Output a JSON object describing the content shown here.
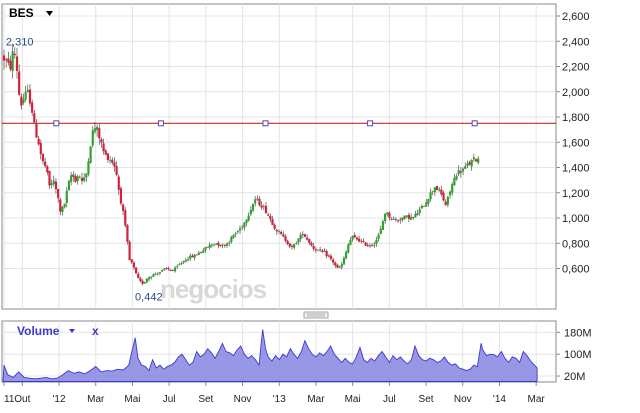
{
  "header": {
    "ticker": "BES",
    "ticker_dropdown_icon": "caret-down-icon",
    "watermark": "negocios"
  },
  "volume_panel": {
    "title": "Volume",
    "dropdown_icon": "caret-down-icon",
    "close_label": "x"
  },
  "colors": {
    "up": "#2fa32f",
    "down": "#d3213a",
    "reference_line": "#c22a2a",
    "volume_fill": "#8585e0",
    "volume_stroke": "#3a3ad0",
    "grid": "#e4e4e4"
  },
  "chart_data": [
    {
      "type": "candlestick",
      "title": "",
      "ylim": [
        400,
        2600
      ],
      "y_ticks": [
        600,
        800,
        1000,
        1200,
        1400,
        1600,
        1800,
        2000,
        2200,
        2400,
        2600
      ],
      "y_tick_labels": [
        "0,600",
        "0,800",
        "1,000",
        "1,200",
        "1,400",
        "1,600",
        "1,800",
        "2,000",
        "2,200",
        "2,400",
        "2,600"
      ],
      "x_tick_labels": [
        "11",
        "Out",
        "'12",
        "Mar",
        "Mai",
        "Jul",
        "Set",
        "Nov",
        "'13",
        "Mar",
        "Mai",
        "Jul",
        "Set",
        "Nov",
        "'14",
        "Mar"
      ],
      "x_ticks_month_index": [
        0,
        1,
        3,
        5,
        7,
        9,
        11,
        13,
        15,
        17,
        19,
        21,
        23,
        25,
        27,
        29
      ],
      "x_range_month_index": [
        -0.05,
        29.05
      ],
      "reference_line": 1750,
      "annotations": [
        {
          "label": "2,310",
          "value": 2310,
          "month_index": 0.05
        },
        {
          "label": "0,442",
          "value": 442,
          "month_index": 7.25
        }
      ],
      "series": [
        {
          "close_path": [
            [
              0.0,
              2280
            ],
            [
              0.25,
              2240
            ],
            [
              0.45,
              2180
            ],
            [
              0.65,
              2350
            ],
            [
              0.85,
              2150
            ],
            [
              1.0,
              1880
            ],
            [
              1.2,
              1950
            ],
            [
              1.4,
              2000
            ],
            [
              1.6,
              1900
            ],
            [
              1.8,
              1700
            ],
            [
              2.0,
              1600
            ],
            [
              2.2,
              1450
            ],
            [
              2.4,
              1400
            ],
            [
              2.6,
              1250
            ],
            [
              2.8,
              1300
            ],
            [
              3.0,
              1200
            ],
            [
              3.2,
              1050
            ],
            [
              3.4,
              1100
            ],
            [
              3.6,
              1250
            ],
            [
              3.8,
              1350
            ],
            [
              4.0,
              1300
            ],
            [
              4.2,
              1350
            ],
            [
              4.4,
              1280
            ],
            [
              4.6,
              1350
            ],
            [
              4.8,
              1550
            ],
            [
              5.0,
              1720
            ],
            [
              5.2,
              1700
            ],
            [
              5.4,
              1600
            ],
            [
              5.6,
              1500
            ],
            [
              5.8,
              1480
            ],
            [
              6.0,
              1450
            ],
            [
              6.2,
              1400
            ],
            [
              6.4,
              1200
            ],
            [
              6.6,
              1050
            ],
            [
              6.8,
              850
            ],
            [
              7.0,
              620
            ],
            [
              7.1,
              650
            ],
            [
              7.2,
              600
            ],
            [
              7.35,
              540
            ],
            [
              7.5,
              500
            ],
            [
              7.7,
              480
            ],
            [
              7.9,
              520
            ],
            [
              8.1,
              540
            ],
            [
              8.4,
              560
            ],
            [
              8.7,
              580
            ],
            [
              9.0,
              600
            ],
            [
              9.3,
              580
            ],
            [
              9.6,
              620
            ],
            [
              9.9,
              660
            ],
            [
              10.2,
              690
            ],
            [
              10.5,
              700
            ],
            [
              10.8,
              730
            ],
            [
              11.1,
              760
            ],
            [
              11.4,
              790
            ],
            [
              11.7,
              800
            ],
            [
              12.0,
              780
            ],
            [
              12.3,
              800
            ],
            [
              12.6,
              860
            ],
            [
              12.9,
              900
            ],
            [
              13.2,
              960
            ],
            [
              13.5,
              1050
            ],
            [
              13.8,
              1150
            ],
            [
              14.0,
              1120
            ],
            [
              14.3,
              1080
            ],
            [
              14.6,
              1000
            ],
            [
              14.9,
              920
            ],
            [
              15.2,
              870
            ],
            [
              15.5,
              820
            ],
            [
              15.8,
              760
            ],
            [
              16.1,
              820
            ],
            [
              16.4,
              880
            ],
            [
              16.7,
              820
            ],
            [
              17.0,
              760
            ],
            [
              17.3,
              740
            ],
            [
              17.6,
              720
            ],
            [
              17.9,
              680
            ],
            [
              18.1,
              640
            ],
            [
              18.3,
              600
            ],
            [
              18.5,
              620
            ],
            [
              18.7,
              700
            ],
            [
              18.9,
              800
            ],
            [
              19.1,
              850
            ],
            [
              19.4,
              830
            ],
            [
              19.7,
              800
            ],
            [
              20.0,
              780
            ],
            [
              20.3,
              800
            ],
            [
              20.6,
              880
            ],
            [
              20.9,
              1050
            ],
            [
              21.2,
              1000
            ],
            [
              21.5,
              980
            ],
            [
              21.8,
              1000
            ],
            [
              22.1,
              1010
            ],
            [
              22.4,
              1000
            ],
            [
              22.7,
              1050
            ],
            [
              23.0,
              1100
            ],
            [
              23.3,
              1180
            ],
            [
              23.6,
              1250
            ],
            [
              23.9,
              1200
            ],
            [
              24.2,
              1100
            ],
            [
              24.5,
              1250
            ],
            [
              24.8,
              1360
            ],
            [
              25.1,
              1380
            ],
            [
              25.4,
              1420
            ],
            [
              25.7,
              1460
            ],
            [
              25.9,
              1470
            ]
          ]
        }
      ]
    },
    {
      "type": "area",
      "title": "Volume",
      "ylim": [
        0,
        200
      ],
      "y_ticks": [
        20,
        100,
        180
      ],
      "y_tick_labels": [
        "20M",
        "100M",
        "180M"
      ],
      "x_range_month_index": [
        -0.05,
        29.05
      ],
      "series": [
        {
          "name": "Volume",
          "values": [
            [
              -0.05,
              10
            ],
            [
              0.0,
              60
            ],
            [
              0.2,
              25
            ],
            [
              0.5,
              15
            ],
            [
              0.8,
              35
            ],
            [
              1.1,
              15
            ],
            [
              1.4,
              12
            ],
            [
              1.7,
              10
            ],
            [
              2.0,
              12
            ],
            [
              2.3,
              15
            ],
            [
              2.6,
              10
            ],
            [
              2.9,
              12
            ],
            [
              3.2,
              25
            ],
            [
              3.5,
              40
            ],
            [
              3.8,
              30
            ],
            [
              4.1,
              35
            ],
            [
              4.4,
              28
            ],
            [
              4.7,
              40
            ],
            [
              5.0,
              55
            ],
            [
              5.3,
              35
            ],
            [
              5.6,
              40
            ],
            [
              5.9,
              38
            ],
            [
              6.2,
              45
            ],
            [
              6.5,
              42
            ],
            [
              6.8,
              60
            ],
            [
              7.0,
              120
            ],
            [
              7.15,
              160
            ],
            [
              7.3,
              85
            ],
            [
              7.5,
              60
            ],
            [
              7.7,
              55
            ],
            [
              7.9,
              40
            ],
            [
              8.1,
              80
            ],
            [
              8.3,
              50
            ],
            [
              8.5,
              60
            ],
            [
              8.7,
              45
            ],
            [
              8.9,
              55
            ],
            [
              9.1,
              60
            ],
            [
              9.3,
              70
            ],
            [
              9.5,
              90
            ],
            [
              9.7,
              100
            ],
            [
              9.9,
              80
            ],
            [
              10.1,
              60
            ],
            [
              10.3,
              70
            ],
            [
              10.5,
              110
            ],
            [
              10.7,
              90
            ],
            [
              10.9,
              100
            ],
            [
              11.1,
              120
            ],
            [
              11.3,
              105
            ],
            [
              11.5,
              85
            ],
            [
              11.7,
              110
            ],
            [
              11.9,
              140
            ],
            [
              12.1,
              110
            ],
            [
              12.3,
              105
            ],
            [
              12.5,
              95
            ],
            [
              12.7,
              115
            ],
            [
              12.9,
              130
            ],
            [
              13.1,
              100
            ],
            [
              13.3,
              85
            ],
            [
              13.5,
              95
            ],
            [
              13.7,
              80
            ],
            [
              13.9,
              60
            ],
            [
              14.0,
              130
            ],
            [
              14.1,
              190
            ],
            [
              14.25,
              120
            ],
            [
              14.4,
              90
            ],
            [
              14.6,
              75
            ],
            [
              14.8,
              95
            ],
            [
              15.0,
              80
            ],
            [
              15.2,
              100
            ],
            [
              15.4,
              90
            ],
            [
              15.6,
              120
            ],
            [
              15.8,
              100
            ],
            [
              16.0,
              85
            ],
            [
              16.2,
              110
            ],
            [
              16.4,
              150
            ],
            [
              16.6,
              120
            ],
            [
              16.8,
              100
            ],
            [
              17.0,
              90
            ],
            [
              17.2,
              105
            ],
            [
              17.4,
              95
            ],
            [
              17.6,
              110
            ],
            [
              17.8,
              130
            ],
            [
              18.0,
              100
            ],
            [
              18.2,
              85
            ],
            [
              18.4,
              70
            ],
            [
              18.6,
              85
            ],
            [
              18.8,
              70
            ],
            [
              19.0,
              65
            ],
            [
              19.2,
              90
            ],
            [
              19.4,
              125
            ],
            [
              19.6,
              80
            ],
            [
              19.8,
              70
            ],
            [
              20.0,
              85
            ],
            [
              20.2,
              75
            ],
            [
              20.4,
              95
            ],
            [
              20.6,
              110
            ],
            [
              20.8,
              90
            ],
            [
              21.0,
              70
            ],
            [
              21.2,
              95
            ],
            [
              21.4,
              80
            ],
            [
              21.6,
              90
            ],
            [
              21.8,
              75
            ],
            [
              22.0,
              65
            ],
            [
              22.2,
              80
            ],
            [
              22.4,
              130
            ],
            [
              22.6,
              95
            ],
            [
              22.8,
              80
            ],
            [
              23.0,
              75
            ],
            [
              23.2,
              85
            ],
            [
              23.4,
              80
            ],
            [
              23.6,
              70
            ],
            [
              23.8,
              75
            ],
            [
              24.0,
              90
            ],
            [
              24.2,
              70
            ],
            [
              24.4,
              60
            ],
            [
              24.6,
              65
            ],
            [
              24.8,
              50
            ],
            [
              25.0,
              45
            ],
            [
              25.2,
              40
            ],
            [
              25.4,
              45
            ],
            [
              25.6,
              60
            ],
            [
              25.8,
              55
            ],
            [
              26.0,
              140
            ],
            [
              26.1,
              115
            ],
            [
              26.3,
              95
            ],
            [
              26.5,
              100
            ],
            [
              26.7,
              98
            ],
            [
              26.9,
              90
            ],
            [
              27.1,
              110
            ],
            [
              27.3,
              85
            ],
            [
              27.5,
              70
            ],
            [
              27.7,
              90
            ],
            [
              27.9,
              85
            ],
            [
              28.1,
              70
            ],
            [
              28.3,
              110
            ],
            [
              28.5,
              95
            ],
            [
              28.7,
              75
            ],
            [
              28.9,
              60
            ],
            [
              29.05,
              50
            ]
          ]
        }
      ]
    }
  ]
}
